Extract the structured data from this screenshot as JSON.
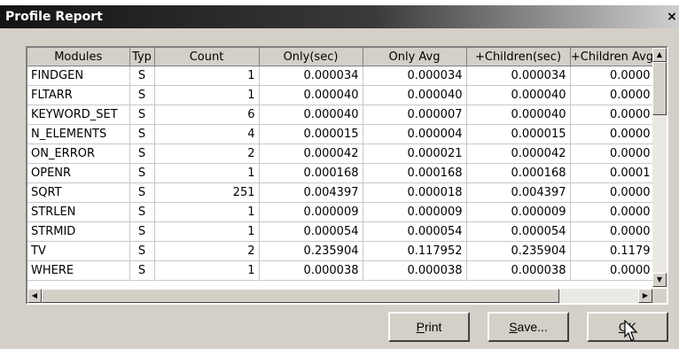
{
  "window": {
    "title": "Profile Report",
    "close_glyph": "×"
  },
  "table": {
    "columns": [
      "Modules",
      "Typ",
      "Count",
      "Only(sec)",
      "Only Avg",
      "+Children(sec)",
      "+Children Avg"
    ],
    "rows": [
      [
        "FINDGEN",
        "S",
        "1",
        "0.000034",
        "0.000034",
        "0.000034",
        "0.0000"
      ],
      [
        "FLTARR",
        "S",
        "1",
        "0.000040",
        "0.000040",
        "0.000040",
        "0.0000"
      ],
      [
        "KEYWORD_SET",
        "S",
        "6",
        "0.000040",
        "0.000007",
        "0.000040",
        "0.0000"
      ],
      [
        "N_ELEMENTS",
        "S",
        "4",
        "0.000015",
        "0.000004",
        "0.000015",
        "0.0000"
      ],
      [
        "ON_ERROR",
        "S",
        "2",
        "0.000042",
        "0.000021",
        "0.000042",
        "0.0000"
      ],
      [
        "OPENR",
        "S",
        "1",
        "0.000168",
        "0.000168",
        "0.000168",
        "0.0001"
      ],
      [
        "SQRT",
        "S",
        "251",
        "0.004397",
        "0.000018",
        "0.004397",
        "0.0000"
      ],
      [
        "STRLEN",
        "S",
        "1",
        "0.000009",
        "0.000009",
        "0.000009",
        "0.0000"
      ],
      [
        "STRMID",
        "S",
        "1",
        "0.000054",
        "0.000054",
        "0.000054",
        "0.0000"
      ],
      [
        "TV",
        "S",
        "2",
        "0.235904",
        "0.117952",
        "0.235904",
        "0.1179"
      ],
      [
        "WHERE",
        "S",
        "1",
        "0.000038",
        "0.000038",
        "0.000038",
        "0.0000"
      ]
    ]
  },
  "buttons": {
    "print": {
      "mnemonic": "P",
      "rest": "rint"
    },
    "save": {
      "mnemonic": "S",
      "rest": "ave..."
    },
    "ok": {
      "mnemonic": "O",
      "rest": "K"
    }
  },
  "icons": {
    "scroll_up": "scroll-up-arrow-icon",
    "scroll_down": "scroll-down-arrow-icon",
    "scroll_left": "scroll-left-arrow-icon",
    "scroll_right": "scroll-right-arrow-icon",
    "cursor": "mouse-pointer-icon"
  }
}
